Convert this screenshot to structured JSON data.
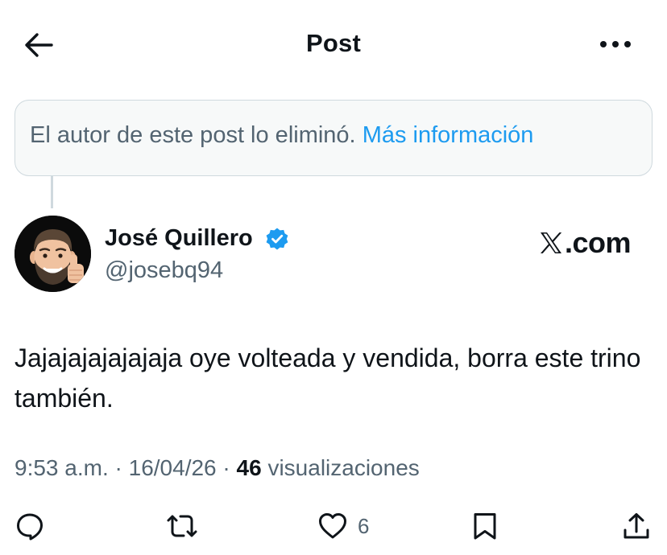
{
  "header": {
    "title": "Post",
    "back_icon": "arrow-left-icon",
    "more_icon": "more-horizontal-icon"
  },
  "notice": {
    "text": "El autor de este post lo eliminó.",
    "link": "Más información"
  },
  "author": {
    "name": "José Quillero",
    "handle": "@josebq94",
    "verified": true,
    "verified_color": "#1d9bf0",
    "avatar_icon": "memoji-avatar"
  },
  "brand": {
    "logo_text": ".com",
    "logo_icon": "x-logo-icon"
  },
  "post": {
    "text": "Jajajajajajajaja oye volteada y vendida, borra este trino también.",
    "time": "9:53 a.m.",
    "date": "16/04/26",
    "views_count": "46",
    "views_label": "visualizaciones"
  },
  "actions": {
    "reply_icon": "reply-icon",
    "repost_icon": "repost-icon",
    "like_icon": "heart-icon",
    "like_count": "6",
    "bookmark_icon": "bookmark-icon",
    "share_icon": "share-icon"
  },
  "colors": {
    "accent": "#1d9bf0",
    "text": "#0f1419",
    "secondary": "#536471",
    "border": "#cfd9de"
  }
}
